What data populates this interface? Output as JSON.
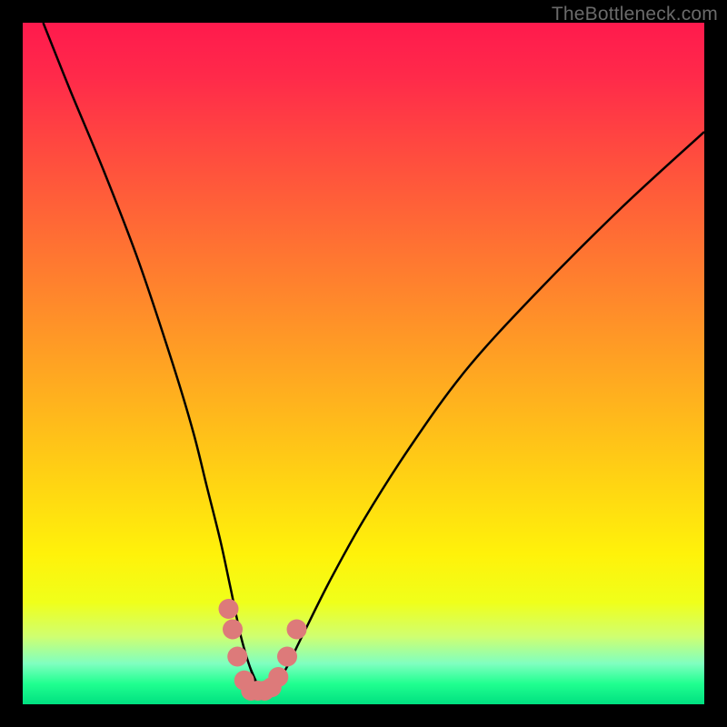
{
  "watermark": "TheBottleneck.com",
  "chart_data": {
    "type": "line",
    "title": "",
    "xlabel": "",
    "ylabel": "",
    "xlim": [
      0,
      100
    ],
    "ylim": [
      0,
      100
    ],
    "series": [
      {
        "name": "bottleneck-curve",
        "x": [
          3,
          7,
          12,
          17,
          22,
          25,
          27,
          29,
          30.5,
          32,
          33.5,
          35,
          36.5,
          38.5,
          41,
          45,
          50,
          57,
          65,
          75,
          88,
          100
        ],
        "y": [
          100,
          90,
          78,
          65,
          50,
          40,
          32,
          24,
          17,
          10,
          5,
          2,
          2,
          5,
          10,
          18,
          27,
          38,
          49,
          60,
          73,
          84
        ]
      }
    ],
    "markers": {
      "name": "highlight-points",
      "color": "#dd7a7a",
      "points": [
        {
          "x": 30.2,
          "y": 14
        },
        {
          "x": 30.8,
          "y": 11
        },
        {
          "x": 31.5,
          "y": 7
        },
        {
          "x": 32.5,
          "y": 3.5
        },
        {
          "x": 33.5,
          "y": 2
        },
        {
          "x": 34.5,
          "y": 2
        },
        {
          "x": 35.5,
          "y": 2
        },
        {
          "x": 36.5,
          "y": 2.5
        },
        {
          "x": 37.5,
          "y": 4
        },
        {
          "x": 38.8,
          "y": 7
        },
        {
          "x": 40.2,
          "y": 11
        }
      ]
    }
  }
}
